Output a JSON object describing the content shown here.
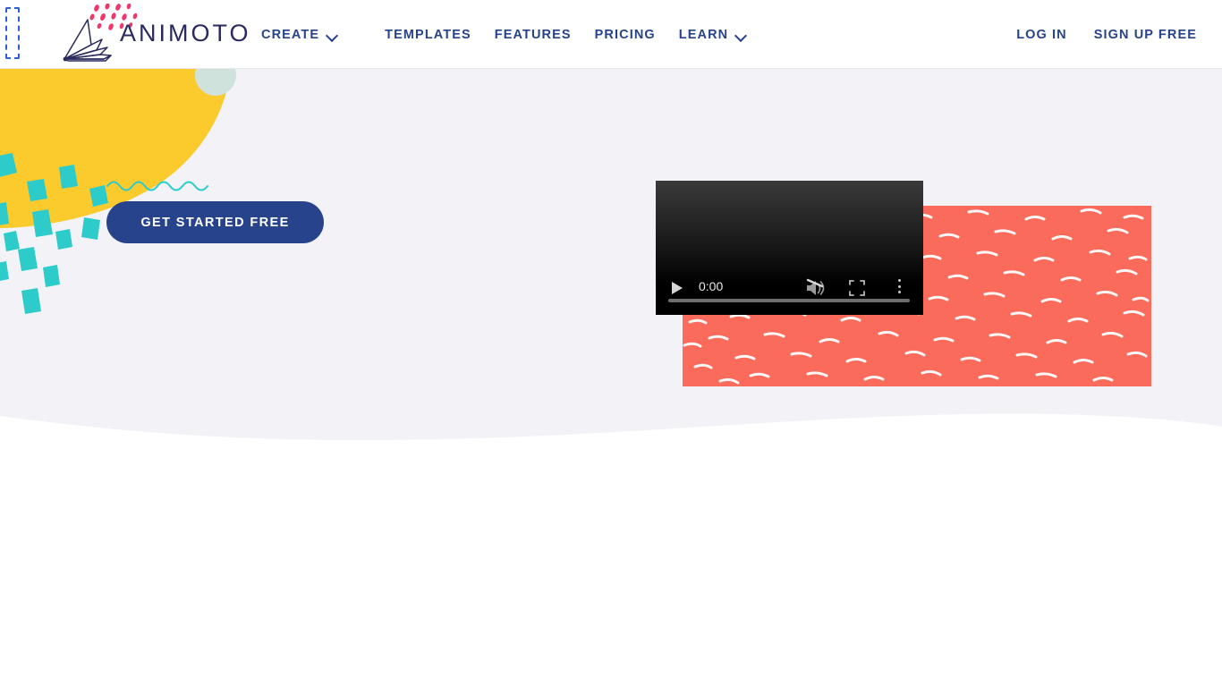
{
  "header": {
    "skip_link_name": "skip-to-content",
    "logo": {
      "wordmark": "ANIMOTO",
      "mark_icon": "animoto-fan-logo-icon",
      "dots_icon": "confetti-dots-icon"
    },
    "nav": [
      {
        "label": "CREATE",
        "has_dropdown": true,
        "icon": "chevron-down-icon"
      },
      {
        "label": "TEMPLATES",
        "has_dropdown": false
      },
      {
        "label": "FEATURES",
        "has_dropdown": false
      },
      {
        "label": "PRICING",
        "has_dropdown": false
      },
      {
        "label": "LEARN",
        "has_dropdown": true,
        "icon": "chevron-down-icon"
      }
    ],
    "auth": [
      {
        "label": "LOG IN"
      },
      {
        "label": "SIGN UP FREE"
      }
    ]
  },
  "hero": {
    "cta_label": "GET STARTED FREE",
    "decor": {
      "yellow_blob": "yellow-blob-shape",
      "teal_confetti": "teal-confetti-squares",
      "mint_circle": "mint-semicircle",
      "squiggle": "teal-squiggle-line",
      "coral_image": "coral-feather-pattern-image"
    },
    "video": {
      "current_time": "0:00",
      "play_label": "play-button",
      "mute_label": "unmute-button",
      "fullscreen_label": "fullscreen-button",
      "more_label": "more-options-button",
      "progress_label": "seek-slider"
    }
  },
  "colors": {
    "navy": "#27438b",
    "yellow": "#fbcb2e",
    "teal": "#2dcccb",
    "coral": "#fb6b5b",
    "mint": "#cfe3dc",
    "pink": "#f0376b",
    "background": "#f2f2f7",
    "logo_ink": "#2a2a5e"
  }
}
